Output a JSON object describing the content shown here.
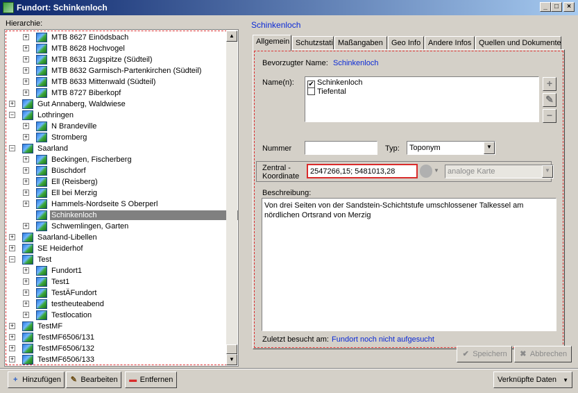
{
  "window": {
    "title": "Fundort: Schinkenloch",
    "buttons": {
      "minimize": "_",
      "maximize": "□",
      "close": "×"
    }
  },
  "left": {
    "header": "Hierarchie:",
    "tree": [
      {
        "label": "MTB 8627 Einödsbach",
        "level": 1,
        "expander": "+"
      },
      {
        "label": "MTB 8628 Hochvogel",
        "level": 1,
        "expander": "+"
      },
      {
        "label": "MTB 8631 Zugspitze (Südteil)",
        "level": 1,
        "expander": "+"
      },
      {
        "label": "MTB 8632 Garmisch-Partenkirchen (Südteil)",
        "level": 1,
        "expander": "+"
      },
      {
        "label": "MTB 8633 Mittenwald (Südteil)",
        "level": 1,
        "expander": "+"
      },
      {
        "label": "MTB 8727 Biberkopf",
        "level": 1,
        "expander": "+"
      },
      {
        "label": "Gut Annaberg, Waldwiese",
        "level": 0,
        "expander": "+"
      },
      {
        "label": "Lothringen",
        "level": 0,
        "expander": "−"
      },
      {
        "label": "N Brandeville",
        "level": 1,
        "expander": "+"
      },
      {
        "label": "Stromberg",
        "level": 1,
        "expander": "+"
      },
      {
        "label": "Saarland",
        "level": 0,
        "expander": "−"
      },
      {
        "label": "Beckingen, Fischerberg",
        "level": 1,
        "expander": "+"
      },
      {
        "label": "Büschdorf",
        "level": 1,
        "expander": "+"
      },
      {
        "label": "Ell (Reisberg)",
        "level": 1,
        "expander": "+"
      },
      {
        "label": "Ell bei Merzig",
        "level": 1,
        "expander": "+"
      },
      {
        "label": "Hammels-Nordseite S Oberperl",
        "level": 1,
        "expander": "+"
      },
      {
        "label": "Schinkenloch",
        "level": 1,
        "expander": "",
        "selected": true
      },
      {
        "label": "Schwemlingen, Garten",
        "level": 1,
        "expander": "+"
      },
      {
        "label": "Saarland-Libellen",
        "level": 0,
        "expander": "+"
      },
      {
        "label": "SE Heiderhof",
        "level": 0,
        "expander": "+"
      },
      {
        "label": "Test",
        "level": 0,
        "expander": "−"
      },
      {
        "label": "Fundort1",
        "level": 1,
        "expander": "+"
      },
      {
        "label": "Test1",
        "level": 1,
        "expander": "+"
      },
      {
        "label": "TestÄFundort",
        "level": 1,
        "expander": "+"
      },
      {
        "label": "testheuteabend",
        "level": 1,
        "expander": "+"
      },
      {
        "label": "Testlocation",
        "level": 1,
        "expander": "+"
      },
      {
        "label": "TestMF",
        "level": 0,
        "expander": "+"
      },
      {
        "label": "TestMF6506/131",
        "level": 0,
        "expander": "+"
      },
      {
        "label": "TestMF6506/132",
        "level": 0,
        "expander": "+"
      },
      {
        "label": "TestMF6506/133",
        "level": 0,
        "expander": "+"
      }
    ],
    "scroll_up": "▲",
    "scroll_down": "▼"
  },
  "right": {
    "title": "Schinkenloch",
    "tabs": [
      "Allgemein",
      "Schutzstati",
      "Maßangaben",
      "Geo Info",
      "Andere Infos",
      "Quellen und Dokumente"
    ],
    "active_tab": "Allgemein",
    "form": {
      "preferred_name_label": "Bevorzugter Name:",
      "preferred_name_value": "Schinkenloch",
      "names_label": "Name(n):",
      "names": [
        {
          "label": "Schinkenloch",
          "checked": "✔"
        },
        {
          "label": "Tiefental",
          "checked": ""
        }
      ],
      "add_icon": "+",
      "edit_icon": "✎",
      "remove_icon": "−",
      "nummer_label": "Nummer",
      "nummer_value": "",
      "typ_label": "Typ:",
      "typ_value": "Toponym",
      "zentral_label_1": "Zentral -",
      "zentral_label_2": "Koordinate",
      "coord_value": "2547266,15; 5481013,28",
      "map_type_value": "analoge Karte",
      "desc_label": "Beschreibung:",
      "desc_value": "Von drei Seiten von der Sandstein-Schichtstufe umschlossener Talkessel am nördlichen Ortsrand von Merzig",
      "last_visit_label": "Zuletzt besucht am:",
      "last_visit_value": "Fundort noch nicht aufgesucht"
    },
    "save_label": "Speichern",
    "cancel_label": "Abbrechen",
    "save_icon": "✔",
    "cancel_icon": "✖"
  },
  "footer": {
    "add_label": "Hinzufügen",
    "edit_label": "Bearbeiten",
    "remove_label": "Entfernen",
    "linked_label": "Verknüpfte Daten",
    "add_icon": "+",
    "edit_icon": "✎",
    "remove_icon": "▬",
    "dropdown_icon": "▼"
  }
}
